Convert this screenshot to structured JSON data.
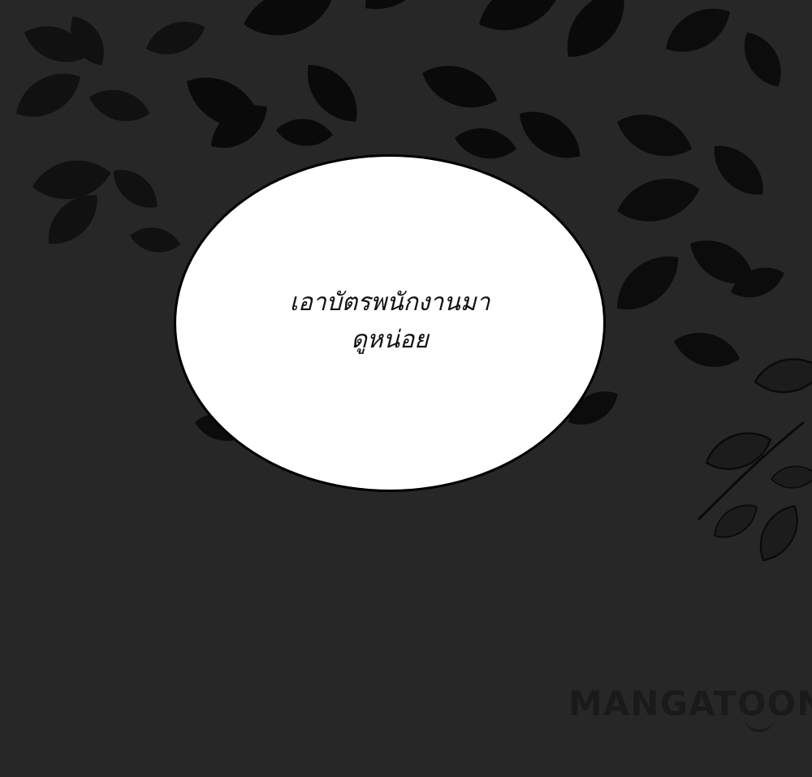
{
  "speech_bubble": {
    "line1": "เอาบัตรพนักงานมา",
    "line2": "ดูหน่อย"
  },
  "watermark": {
    "text": "MANGATOON"
  },
  "colors": {
    "background": "#272727",
    "foliage": "#0d0d0d",
    "bubble_fill": "#ffffff",
    "bubble_border": "#000000"
  }
}
